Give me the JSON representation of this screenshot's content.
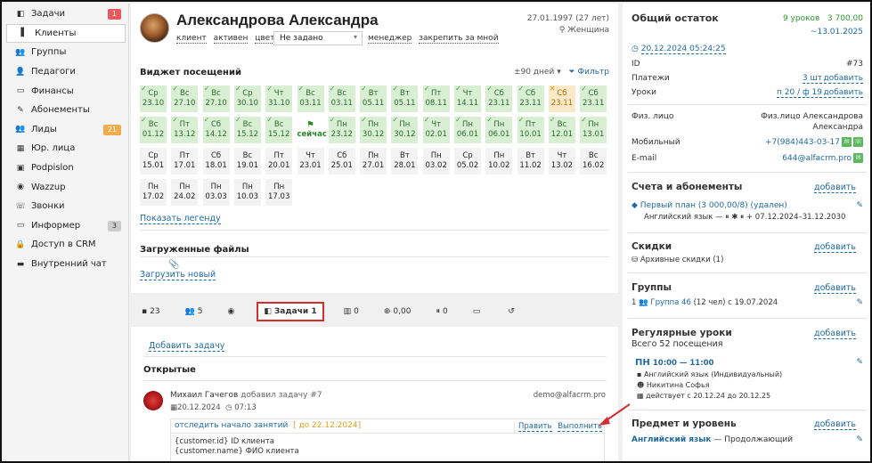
{
  "sidebar": [
    {
      "icon": "◧",
      "label": "Задачи",
      "badge": "1",
      "badge_color": "red",
      "active": false
    },
    {
      "icon": "▌",
      "label": "Клиенты",
      "active": true
    },
    {
      "icon": "👥",
      "label": "Группы"
    },
    {
      "icon": "👤",
      "label": "Педагоги"
    },
    {
      "icon": "▭",
      "label": "Финансы"
    },
    {
      "icon": "✎",
      "label": "Абонементы"
    },
    {
      "icon": "👥",
      "label": "Лиды",
      "badge": "21",
      "badge_color": "orange"
    },
    {
      "icon": "▦",
      "label": "Юр. лица"
    },
    {
      "icon": "▣",
      "label": "Podpislon"
    },
    {
      "icon": "◉",
      "label": "Wazzup"
    },
    {
      "icon": "☏",
      "label": "Звонки"
    },
    {
      "icon": "▭",
      "label": "Информер",
      "badge": "3",
      "badge_color": "gray"
    },
    {
      "icon": "🔒",
      "label": "Доступ в CRM"
    },
    {
      "icon": "▬",
      "label": "Внутренний чат"
    }
  ],
  "client": {
    "name": "Александрова Александра",
    "dob": "27.01.1997 (27 лет)",
    "gender": "Женщина",
    "tags": [
      "клиент",
      "активен",
      "цвет"
    ],
    "select_value": "Не задано",
    "tags2": [
      "менеджер",
      "закрепить за мной"
    ]
  },
  "widget": {
    "title": "Виджет посещений",
    "range": "±90 дней",
    "filter": "Фильтр",
    "legend": "Показать легенду",
    "cells": [
      [
        "g",
        "Ср",
        "23.10"
      ],
      [
        "g",
        "Вс",
        "27.10"
      ],
      [
        "g",
        "Вс",
        "27.10"
      ],
      [
        "g",
        "Ср",
        "30.10"
      ],
      [
        "g",
        "Чт",
        "31.10"
      ],
      [
        "g",
        "Вс",
        "03.11"
      ],
      [
        "g",
        "Вс",
        "03.11"
      ],
      [
        "g",
        "Вт",
        "05.11"
      ],
      [
        "g",
        "Вт",
        "05.11"
      ],
      [
        "g",
        "Пт",
        "08.11"
      ],
      [
        "g",
        "Чт",
        "14.11"
      ],
      [
        "g",
        "Сб",
        "23.11"
      ],
      [
        "g",
        "Сб",
        "23.11"
      ],
      [
        "o",
        "Сб",
        "23.11"
      ],
      [
        "g",
        "Сб",
        "23.11"
      ],
      [
        "g",
        "Вс",
        "01.12"
      ],
      [
        "g",
        "Пт",
        "13.12"
      ],
      [
        "g",
        "Сб",
        "14.12"
      ],
      [
        "g",
        "Вс",
        "15.12"
      ],
      [
        "g",
        "Вс",
        "15.12"
      ],
      [
        "now",
        "",
        "сейчас"
      ],
      [
        "g",
        "Пн",
        "23.12"
      ],
      [
        "g",
        "Пн",
        "30.12"
      ],
      [
        "g",
        "Пн",
        "30.12"
      ],
      [
        "g",
        "Чт",
        "02.01"
      ],
      [
        "g",
        "Пн",
        "06.01"
      ],
      [
        "g",
        "Пн",
        "06.01"
      ],
      [
        "g",
        "Пт",
        "10.01"
      ],
      [
        "g",
        "Вс",
        "12.01"
      ],
      [
        "g",
        "Пн",
        "13.01"
      ],
      [
        "w",
        "Ср",
        "15.01"
      ],
      [
        "w",
        "Пт",
        "17.01"
      ],
      [
        "w",
        "Сб",
        "18.01"
      ],
      [
        "w",
        "Вс",
        "19.01"
      ],
      [
        "w",
        "Пт",
        "20.01"
      ],
      [
        "w",
        "Чт",
        "23.01"
      ],
      [
        "w",
        "Сб",
        "25.01"
      ],
      [
        "w",
        "Пн",
        "27.01"
      ],
      [
        "w",
        "Вт",
        "28.01"
      ],
      [
        "w",
        "Пн",
        "03.02"
      ],
      [
        "w",
        "Ср",
        "05.02"
      ],
      [
        "w",
        "Пн",
        "10.02"
      ],
      [
        "w",
        "Вт",
        "11.02"
      ],
      [
        "w",
        "Чт",
        "13.02"
      ],
      [
        "w",
        "Вс",
        "16.02"
      ],
      [
        "w",
        "Пн",
        "17.02"
      ],
      [
        "w",
        "Пн",
        "24.02"
      ],
      [
        "w",
        "Пн",
        "03.03"
      ],
      [
        "w",
        "Пн",
        "10.03"
      ],
      [
        "w",
        "Пн",
        "17.03"
      ]
    ]
  },
  "files": {
    "title": "Загруженные файлы",
    "upload": "Загрузить новый"
  },
  "tabs": [
    {
      "icon": "▪",
      "label": "23"
    },
    {
      "icon": "👥",
      "label": "5"
    },
    {
      "icon": "◉",
      "label": ""
    },
    {
      "icon": "◧",
      "label": "Задачи 1",
      "active": true
    },
    {
      "icon": "▥",
      "label": "0"
    },
    {
      "icon": "⊕",
      "label": "0,00"
    },
    {
      "icon": "⏸",
      "label": "0"
    },
    {
      "icon": "▭",
      "label": ""
    },
    {
      "icon": "↺",
      "label": ""
    }
  ],
  "tasks": {
    "add": "Добавить задачу",
    "open": "Открытые",
    "author": "Михаил Гачегов",
    "action": "добавил задачу #7",
    "email": "demo@alfacrm.pro",
    "date": "20.12.2024",
    "time": "07:13",
    "task_title": "отследить начало занятий",
    "deadline": "[ до 22.12.2024]",
    "edit": "Править",
    "done": "Выполнить",
    "line1": "{customer.id} ID клиента",
    "line2": "{customer.name} ФИО клиента"
  },
  "right": {
    "balance_title": "Общий остаток",
    "balance_lessons": "9 уроков",
    "balance_amount": "3 700,00",
    "balance_date": "~13.01.2025",
    "updated": "20.12.2024 05:24:25",
    "id_label": "ID",
    "id_value": "#73",
    "pay_label": "Платежи",
    "pay_value": "3 шт",
    "pay_add": "добавить",
    "lessons_label": "Уроки",
    "lessons_value": "п 20 / ф 19",
    "lessons_add": "добавить",
    "person_label": "Физ. лицо",
    "person_value1": "Физ.лицо Александрова",
    "person_value2": "Александра",
    "mobile_label": "Мобильный",
    "mobile_value": "+7(984)443-03-17",
    "email_label": "E-mail",
    "email_value": "644@alfacrm.pro",
    "accounts_title": "Счета и абонементы",
    "accounts_add": "добавить",
    "plan": "Первый план (3 000,00/8) (удален)",
    "plan_detail": "Английский язык — ⏸ ✱ ⏸ + 07.12.2024–31.12.2030",
    "discounts_title": "Скидки",
    "discounts_add": "добавить",
    "archive": "Архивные скидки (1)",
    "groups_title": "Группы",
    "groups_add": "добавить",
    "group_count": "1",
    "group_name": "Группа 46",
    "group_detail": "(12 чел) с 19.07.2024",
    "regular_title": "Регулярные уроки",
    "regular_add": "добавить",
    "regular_sub": "Всего 52 посещения",
    "day": "ПН",
    "day_time": "10:00 — 11:00",
    "reg1": "Английский язык (Индивидуальный)",
    "reg2": "Никитина Софья",
    "reg3": "действует с 20.12.24 до 20.12.25",
    "subject_title": "Предмет и уровень",
    "subject_add": "добавить",
    "subject": "Английский язык",
    "subject_level": "— Продолжающий"
  }
}
